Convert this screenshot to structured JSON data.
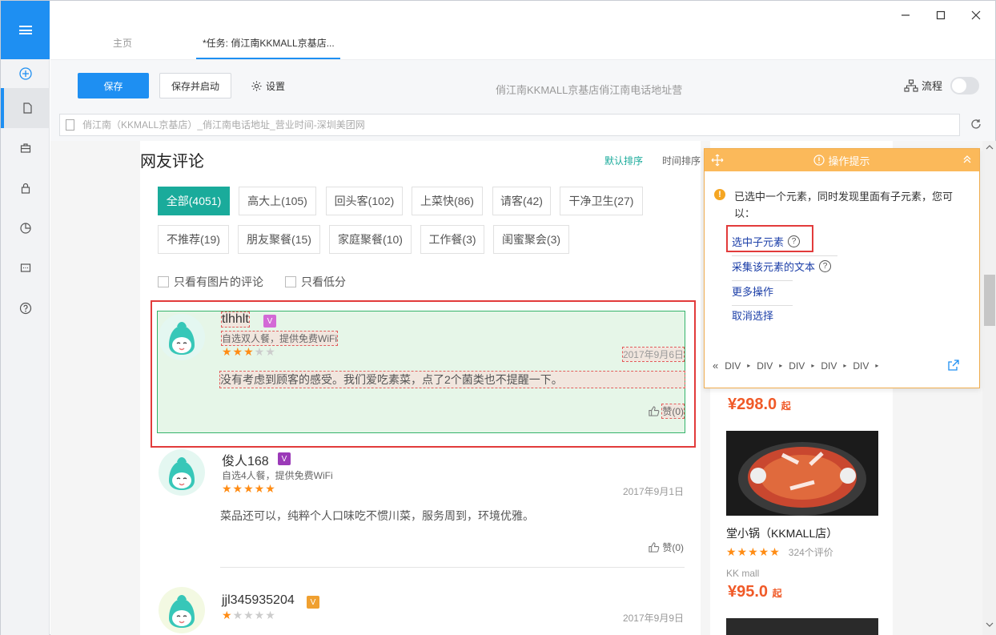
{
  "tabs": {
    "home": "主页",
    "task": "*任务: 俏江南KKMALL京基店..."
  },
  "toolbar": {
    "save": "保存",
    "save_start": "保存并启动",
    "settings": "设置",
    "task_title": "俏江南KKMALL京基店俏江南电话地址营",
    "flow": "流程"
  },
  "address": {
    "url": "俏江南（KKMALL京基店）_俏江南电话地址_营业时间-深圳美团网"
  },
  "reviews": {
    "title": "网友评论",
    "sort_default": "默认排序",
    "sort_time": "时间排序",
    "tags": [
      "全部(4051)",
      "高大上(105)",
      "回头客(102)",
      "上菜快(86)",
      "请客(42)",
      "干净卫生(27)",
      "不推荐(19)",
      "朋友聚餐(15)",
      "家庭聚餐(10)",
      "工作餐(3)",
      "闺蜜聚会(3)"
    ],
    "filters": [
      "只看有图片的评论",
      "只看低分"
    ],
    "items": [
      {
        "name": "tlhhlt",
        "badge": "V",
        "meal": "自选双人餐，提供免费WiFi",
        "stars": 3,
        "date": "2017年9月6日",
        "text": "没有考虑到顾客的感受。我们爱吃素菜，点了2个菌类也不提醒一下。",
        "like": "赞(0)"
      },
      {
        "name": "俊人168",
        "badge": "V",
        "meal": "自选4人餐，提供免费WiFi",
        "stars": 5,
        "date": "2017年9月1日",
        "text": "菜品还可以，纯粹个人口味吃不惯川菜，服务周到，环境优雅。",
        "like": "赞(0)"
      },
      {
        "name": "jjl345935204",
        "badge": "V",
        "stars": 1,
        "date": "2017年9月9日"
      }
    ]
  },
  "right": {
    "price1": "¥298.0",
    "price_suffix": "起",
    "shop_name": "堂小锅（KKMALL店）",
    "shop_reviews": "324个评价",
    "shop_area": "KK mall",
    "price2": "¥95.0"
  },
  "hint": {
    "title": "操作提示",
    "message": "已选中一个元素，同时发现里面有子元素，您可以：",
    "links": [
      "选中子元素",
      "采集该元素的文本",
      "更多操作",
      "取消选择"
    ],
    "crumbs": [
      "DIV",
      "DIV",
      "DIV",
      "DIV",
      "DIV"
    ]
  },
  "colors": {
    "accent": "#1e8ff2",
    "teal": "#1aab9b",
    "star": "#ff8c14",
    "highlight": "#e23b3b",
    "hint": "#fbb95a"
  }
}
